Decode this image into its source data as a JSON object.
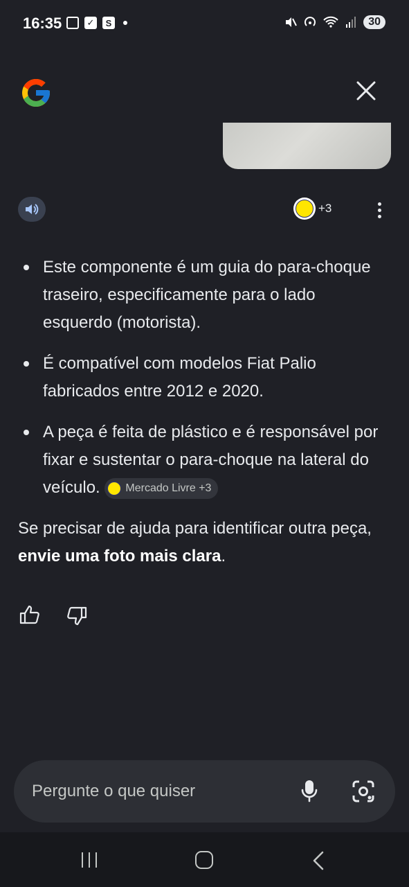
{
  "status_bar": {
    "time": "16:35",
    "s_icon": "S",
    "battery": "30"
  },
  "header": {
    "logo": "google-g-logo",
    "close_icon": "close-icon"
  },
  "actions": {
    "sources_count": "+3"
  },
  "response": {
    "bullets": [
      "Este componente é um guia do para-choque traseiro, especificamente para o lado esquerdo (motorista).",
      "É compatível com modelos Fiat Palio fabricados entre 2012 e 2020.",
      "A peça é feita de plástico e é responsável por fixar e sustentar o para-choque na lateral do veículo."
    ],
    "citation": "Mercado Livre +3",
    "closing_prefix": "Se precisar de ajuda para identificar outra peça, ",
    "closing_bold": "envie uma foto mais clara",
    "closing_suffix": "."
  },
  "input": {
    "placeholder": "Pergunte o que quiser"
  },
  "colors": {
    "background": "#1f2026",
    "text": "#e8eaed",
    "input_bg": "#2d2f35"
  }
}
